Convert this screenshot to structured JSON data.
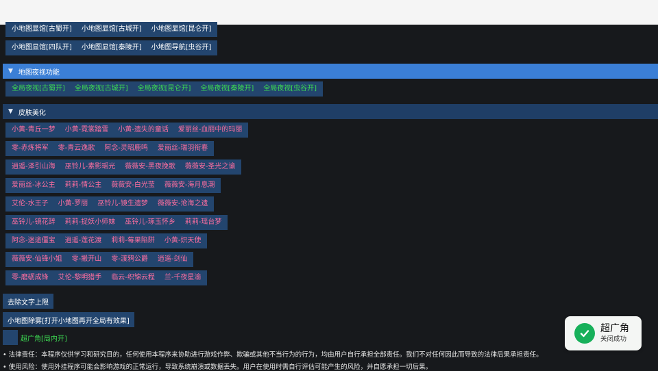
{
  "minimap_rows": [
    [
      "小地图显馆[古蜀开]",
      "小地图显馆[古城开]",
      "小地图显馆[昆仑开]"
    ],
    [
      "小地图显馆[四队开]",
      "小地图显馆[秦陵开]",
      "小地图导航[虫谷开]"
    ]
  ],
  "night_vision": {
    "title": "地图夜视功能",
    "items": [
      "全局夜视[古蜀开]",
      "全局夜视[古城开]",
      "全局夜视[昆仑开]",
      "全局夜视[秦陵开]",
      "全局夜视[虫谷开]"
    ]
  },
  "skins": {
    "title": "皮肤美化",
    "rows": [
      [
        "小黄-青丘一梦",
        "小黄-霓裳踏雪",
        "小黄-遗失的童话",
        "爱丽丝-血丽中的玛丽"
      ],
      [
        "零-赤炼将军",
        "零-青云逸歌",
        "阿念-灵昭鹿鸣",
        "爱丽丝-瑞羽衔春"
      ],
      [
        "逍遥-泽引山海",
        "巫铃儿-素影瑶光",
        "薇薇安-黑夜挽歌",
        "薇薇安-圣光之谕"
      ],
      [
        "爱丽丝-冰公主",
        "莉莉-情公主",
        "薇薇安-白光莹",
        "薇薇安-海月息潮"
      ],
      [
        "艾伦-水王子",
        "小黄-罗丽",
        "巫铃儿-镜生遗梦",
        "薇薇安-沧海之遗"
      ],
      [
        "巫铃儿-镜花辞",
        "莉莉-捉妖小师妹",
        "巫铃儿-琢玉怀乡",
        "莉莉-瑶台梦"
      ],
      [
        "阿念-迷途僵宝",
        "逍遥-莲花渡",
        "莉莉-莓果陷阱",
        "小黄-炽天使"
      ],
      [
        "薇薇安-仙锋小姐",
        "零-搬开山",
        "零-渡鸦公爵",
        "逍遥-剑仙"
      ],
      [
        "零-磨砺成锋",
        "艾伦-黎明猎手",
        "临云-织锦云程",
        "兰-千夜星渝"
      ]
    ]
  },
  "remove_text_limit": "去除文字上限",
  "minimap_fog": "小地图除雾[打开小地图再开全局有效果]",
  "super_wide": {
    "label": "超广角[局内开]",
    "checked": false
  },
  "notes": [
    "• 法律责任：本程序仅供学习和研究目的，任何使用本程序来协助进行游戏作弊、欺骗或其他不当行为的行为，均由用户自行承担全部责任。我们不对任何因此而导致的法律后果承担责任。",
    "• 使用风险：使用外挂程序可能会影响游戏的正常运行，导致系统崩溃或数据丢失。用户在使用时需自行评估可能产生的风险，并自愿承担一切后果。"
  ],
  "toast": {
    "title": "超广角",
    "subtitle": "关闭成功"
  },
  "colors": {
    "accent_blue": "#3b7fd6",
    "button_bg": "#23456e",
    "green_text": "#3ddc52",
    "pink_text": "#ff6ea0",
    "success": "#17b05a"
  }
}
